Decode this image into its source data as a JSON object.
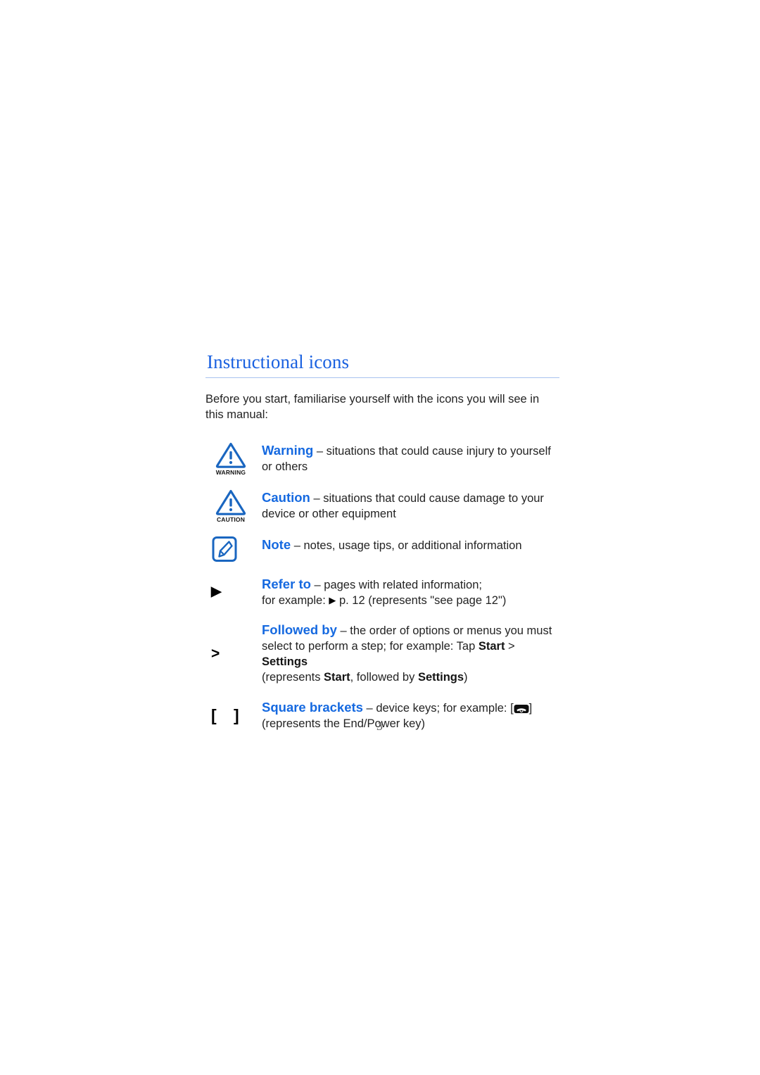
{
  "document": {
    "section_title": "Instructional icons",
    "intro": "Before you start, familiarise yourself with the icons you will see in this manual:",
    "page_number": "3"
  },
  "colors": {
    "heading_blue": "#1a61e0",
    "term_blue": "#1569e0",
    "rule_blue": "#a8c3ef",
    "icon_blue": "#1a66c0",
    "body_text": "#232323"
  },
  "icon_entries": [
    {
      "icon": "warning-triangle-icon",
      "icon_label": "WARNING",
      "term": "Warning",
      "dash": " – ",
      "description": "situations that could cause injury to yourself or others"
    },
    {
      "icon": "caution-triangle-icon",
      "icon_label": "CAUTION",
      "term": "Caution",
      "dash": " – ",
      "description": "situations that could cause damage to your device or other equipment"
    },
    {
      "icon": "note-pen-icon",
      "icon_label": "",
      "term": "Note",
      "dash": " – ",
      "description": "notes, usage tips, or additional information"
    },
    {
      "icon": "refer-to-triangle-icon",
      "icon_label": "▶",
      "term": "Refer to",
      "dash": " – ",
      "description": "pages with related information;",
      "example_prefix": "for example: ",
      "example_suffix": " p. 12 (represents \"see page 12\")"
    },
    {
      "icon": "followed-by-greater-than-icon",
      "icon_label": ">",
      "term": "Followed by",
      "dash": " – ",
      "description": "the order of options or menus you must select to perform a step; for example: Tap ",
      "bold_1": "Start",
      "separator": " > ",
      "bold_2": "Settings",
      "line3_prefix": "(represents ",
      "line3_bold_1": "Start",
      "line3_middle": ", followed by ",
      "line3_bold_2": "Settings",
      "line3_suffix": ")"
    },
    {
      "icon": "square-brackets-icon",
      "icon_label": "[    ]",
      "term": "Square brackets",
      "dash": " – ",
      "description": "device keys; for example: [",
      "key_icon": "end-power-key-icon",
      "description_tail": "]",
      "line2": "(represents the End/Power key)"
    }
  ]
}
